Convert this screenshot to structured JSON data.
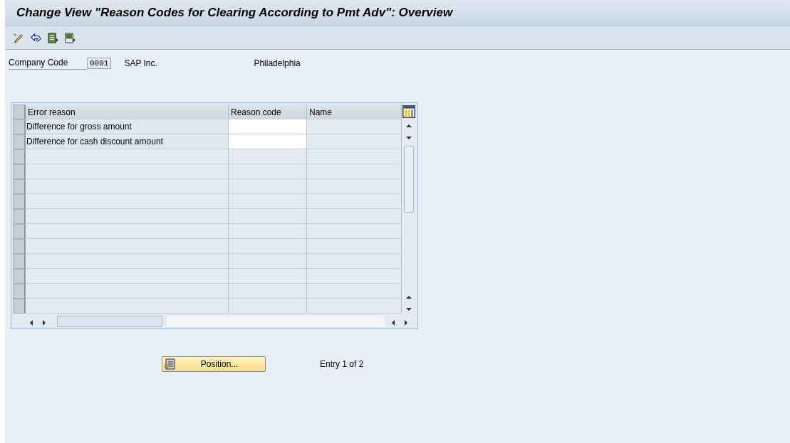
{
  "window": {
    "title": "Change View \"Reason Codes for Clearing According to Pmt Adv\": Overview"
  },
  "toolbar": {
    "icons": [
      {
        "kind": "pencil"
      },
      {
        "kind": "undo"
      },
      {
        "kind": "doc"
      },
      {
        "kind": "doc2"
      }
    ]
  },
  "header": {
    "label": "Company Code",
    "value": "0001",
    "company_name": "SAP Inc.",
    "city": "Philadelphia"
  },
  "table": {
    "columns": [
      "Error reason",
      "Reason code",
      "Name"
    ],
    "rows": [
      {
        "error_reason": "Difference for gross amount"
      },
      {
        "error_reason": "Difference for cash discount amount"
      }
    ]
  },
  "position_button": "Position...",
  "entry_info": "Entry 1 of 2"
}
